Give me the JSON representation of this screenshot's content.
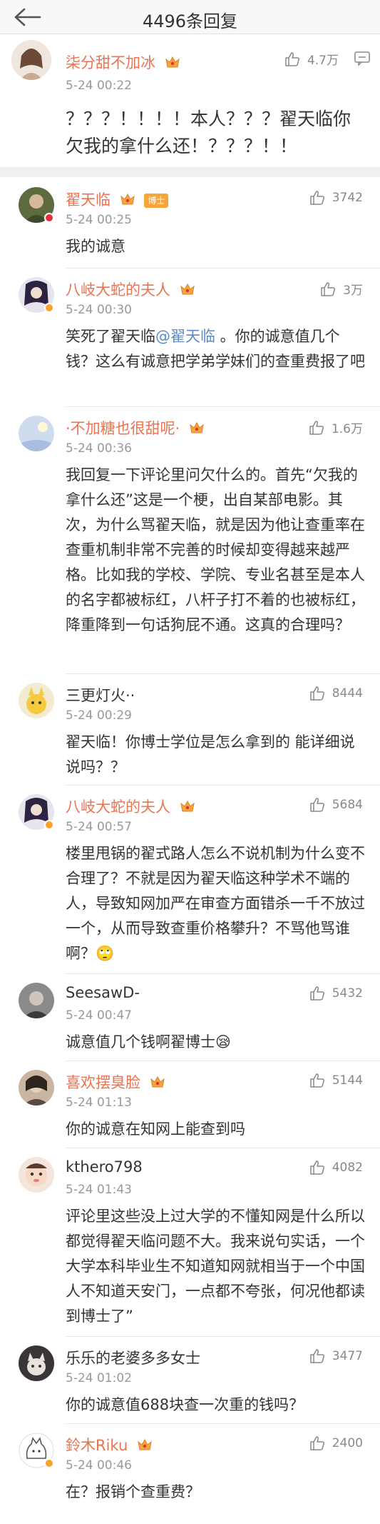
{
  "header": {
    "title": "4496条回复"
  },
  "root": {
    "name": "柒分甜不加冰",
    "time": "5-24 00:22",
    "likes": "4.7万",
    "content": "？？？！！！！本人？？？翟天临你欠我的拿什么还！？？？！！"
  },
  "comments": [
    {
      "name": "翟天临",
      "badge": "博士",
      "time": "5-24 00:25",
      "likes": "3742",
      "content": "我的诚意"
    },
    {
      "name": "八岐大蛇的夫人",
      "time": "5-24 00:30",
      "likes": "3万",
      "content_pre": "笑死了翟天临",
      "mention": "@翟天临",
      "content_post": " 。你的诚意值几个钱？这么有诚意把学弟学妹们的查重费报了吧"
    },
    {
      "name": "·不加糖也很甜呢·",
      "time": "5-24 00:36",
      "likes": "1.6万",
      "content": "我回复一下评论里问欠什么的。首先“欠我的拿什么还”这是一个梗，出自某部电影。其次，为什么骂翟天临，就是因为他让查重率在查重机制非常不完善的时候却变得越来越严格。比如我的学校、学院、专业名甚至是本人的名字都被标红，八杆子打不着的也被标红，降重降到一句话狗屁不通。这真的合理吗？"
    },
    {
      "name": "三更灯火··",
      "time": "5-24 00:29",
      "likes": "8444",
      "content": "翟天临！你博士学位是怎么拿到的 能详细说说吗？？"
    },
    {
      "name": "八岐大蛇的夫人",
      "time": "5-24 00:57",
      "likes": "5684",
      "content": "楼里甩锅的翟式路人怎么不说机制为什么变不合理了？不就是因为翟天临这种学术不端的人，导致知网加严在审查方面错杀一千不放过一个，从而导致查重价格攀升？不骂他骂谁啊？🙄"
    },
    {
      "name": "SeesawD-",
      "time": "5-24 00:47",
      "likes": "5432",
      "content": "诚意值几个钱啊翟博士😪"
    },
    {
      "name": "喜欢摆臭脸",
      "time": "5-24 01:13",
      "likes": "5144",
      "content": "你的诚意在知网上能查到吗"
    },
    {
      "name": "kthero798",
      "time": "5-24 01:43",
      "likes": "4082",
      "content": "评论里这些没上过大学的不懂知网是什么所以都觉得翟天临问题不大。我来说句实话，一个大学本科毕业生不知道知网就相当于一个中国人不知道天安门，一点都不夸张，何况他都读到博士了”"
    },
    {
      "name": "乐乐的老婆多多女士",
      "time": "5-24 01:02",
      "likes": "3477",
      "content": "你的诚意值688块查一次重的钱吗？"
    },
    {
      "name": "鈴木Riku",
      "time": "5-24 00:46",
      "likes": "2400",
      "content": "在？报销个查重费？"
    }
  ],
  "colors": {
    "name_orange": "#eb7350",
    "mention_blue": "#5b8ac8",
    "crown_gold": "#f7a43a"
  },
  "icons": {
    "back": "arrow-left-icon",
    "like": "thumbs-up-icon",
    "more": "comment-more-icon"
  }
}
